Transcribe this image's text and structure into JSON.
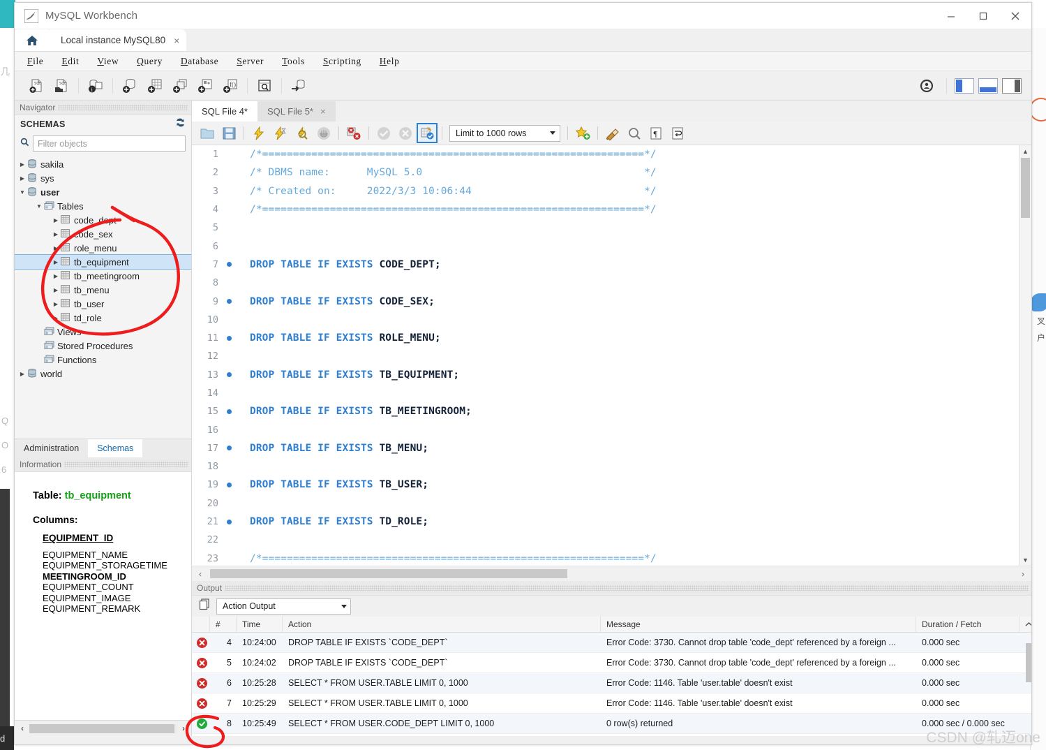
{
  "window": {
    "title": "MySQL Workbench",
    "logo_icon": "mysql-dolphin-icon",
    "minimize_label": "minimize-icon",
    "maximize_label": "maximize-icon",
    "close_label": "close-icon"
  },
  "tabs": {
    "home_icon": "home-icon",
    "connection_tab": "Local instance MySQL80",
    "close_glyph": "×"
  },
  "menubar": {
    "items": [
      {
        "mnemonic": "F",
        "rest": "ile"
      },
      {
        "mnemonic": "E",
        "rest": "dit"
      },
      {
        "mnemonic": "V",
        "rest": "iew"
      },
      {
        "mnemonic": "Q",
        "rest": "uery"
      },
      {
        "mnemonic": "D",
        "rest": "atabase"
      },
      {
        "mnemonic": "S",
        "rest": "erver"
      },
      {
        "mnemonic": "T",
        "rest": "ools"
      },
      {
        "mnemonic": "S",
        "rest": "cripting"
      },
      {
        "mnemonic": "H",
        "rest": "elp"
      }
    ]
  },
  "main_toolbar": {
    "icons": [
      "new-sql-tab-icon",
      "open-sql-script-icon",
      "connection-info-icon",
      "new-schema-icon",
      "new-table-icon",
      "new-view-icon",
      "new-routine-icon",
      "new-function-icon",
      "inspect-schema-icon",
      "reconnect-server-icon"
    ],
    "right_icons": [
      "admin-target-icon",
      "toggle-sidebar-icon",
      "toggle-output-icon",
      "toggle-secondary-sidebar-icon"
    ]
  },
  "navigator": {
    "caption": "Navigator",
    "schemas_label": "SCHEMAS",
    "refresh_icon": "refresh-icon",
    "filter_placeholder": "Filter objects",
    "search_icon": "search-icon",
    "tree": [
      {
        "label": "sakila",
        "level": 1,
        "icon": "schema-icon",
        "expanded": false,
        "bold": false,
        "selected": false
      },
      {
        "label": "sys",
        "level": 1,
        "icon": "schema-icon",
        "expanded": false,
        "bold": false,
        "selected": false
      },
      {
        "label": "user",
        "level": 1,
        "icon": "schema-icon",
        "expanded": true,
        "bold": true,
        "selected": false
      },
      {
        "label": "Tables",
        "level": 2,
        "icon": "folder-tables-icon",
        "expanded": true,
        "bold": false,
        "selected": false
      },
      {
        "label": "code_dept",
        "level": 3,
        "icon": "table-icon",
        "expanded": false,
        "bold": false,
        "selected": false
      },
      {
        "label": "code_sex",
        "level": 3,
        "icon": "table-icon",
        "expanded": false,
        "bold": false,
        "selected": false
      },
      {
        "label": "role_menu",
        "level": 3,
        "icon": "table-icon",
        "expanded": false,
        "bold": false,
        "selected": false
      },
      {
        "label": "tb_equipment",
        "level": 3,
        "icon": "table-icon",
        "expanded": false,
        "bold": false,
        "selected": true
      },
      {
        "label": "tb_meetingroom",
        "level": 3,
        "icon": "table-icon",
        "expanded": false,
        "bold": false,
        "selected": false
      },
      {
        "label": "tb_menu",
        "level": 3,
        "icon": "table-icon",
        "expanded": false,
        "bold": false,
        "selected": false
      },
      {
        "label": "tb_user",
        "level": 3,
        "icon": "table-icon",
        "expanded": false,
        "bold": false,
        "selected": false
      },
      {
        "label": "td_role",
        "level": 3,
        "icon": "table-icon",
        "expanded": false,
        "bold": false,
        "selected": false
      },
      {
        "label": "Views",
        "level": 2,
        "icon": "folder-views-icon",
        "expanded": false,
        "bold": false,
        "selected": false
      },
      {
        "label": "Stored Procedures",
        "level": 2,
        "icon": "folder-procs-icon",
        "expanded": false,
        "bold": false,
        "selected": false
      },
      {
        "label": "Functions",
        "level": 2,
        "icon": "folder-funcs-icon",
        "expanded": false,
        "bold": false,
        "selected": false
      },
      {
        "label": "world",
        "level": 1,
        "icon": "schema-icon",
        "expanded": false,
        "bold": false,
        "selected": false
      }
    ],
    "bottom_tabs": [
      {
        "label": "Administration",
        "active": false
      },
      {
        "label": "Schemas",
        "active": true
      }
    ]
  },
  "information": {
    "caption": "Information",
    "table_prefix": "Table:",
    "table_name": "tb_equipment",
    "columns_label": "Columns:",
    "columns": [
      {
        "name": "EQUIPMENT_ID",
        "key": "pk"
      },
      {
        "name": "EQUIPMENT_NAME",
        "key": ""
      },
      {
        "name": "EQUIPMENT_STORAGETIME",
        "key": ""
      },
      {
        "name": "MEETINGROOM_ID",
        "key": "fk"
      },
      {
        "name": "EQUIPMENT_COUNT",
        "key": ""
      },
      {
        "name": "EQUIPMENT_IMAGE",
        "key": ""
      },
      {
        "name": "EQUIPMENT_REMARK",
        "key": ""
      }
    ]
  },
  "editor": {
    "tabs": [
      {
        "label": "SQL File 4*",
        "active": true,
        "closable": false
      },
      {
        "label": "SQL File 5*",
        "active": false,
        "closable": true
      }
    ],
    "toolbar": {
      "icons": [
        "open-file-icon",
        "save-file-icon",
        "execute-icon",
        "execute-current-icon",
        "explain-icon",
        "stop-icon",
        "toggle-stop-on-error-icon",
        "commit-icon",
        "rollback-icon",
        "autocommit-icon"
      ],
      "limit_label": "Limit to 1000 rows",
      "right_icons": [
        "toggle-snippets-icon",
        "beautify-sql-icon",
        "find-icon",
        "toggle-invisible-chars-icon",
        "wrap-lines-icon"
      ]
    },
    "lines": [
      {
        "n": 1,
        "bp": false,
        "segments": [
          {
            "t": "/*==============================================================*/",
            "c": "cmt"
          }
        ]
      },
      {
        "n": 2,
        "bp": false,
        "segments": [
          {
            "t": "/* DBMS name:      MySQL 5.0                                    */",
            "c": "cmt"
          }
        ]
      },
      {
        "n": 3,
        "bp": false,
        "segments": [
          {
            "t": "/* Created on:     2022/3/3 10:06:44                            */",
            "c": "cmt"
          }
        ]
      },
      {
        "n": 4,
        "bp": false,
        "segments": [
          {
            "t": "/*==============================================================*/",
            "c": "cmt"
          }
        ]
      },
      {
        "n": 5,
        "bp": false,
        "segments": []
      },
      {
        "n": 6,
        "bp": false,
        "segments": []
      },
      {
        "n": 7,
        "bp": true,
        "segments": [
          {
            "t": "DROP TABLE IF EXISTS ",
            "c": "kw"
          },
          {
            "t": "CODE_DEPT;",
            "c": "idn"
          }
        ]
      },
      {
        "n": 8,
        "bp": false,
        "segments": []
      },
      {
        "n": 9,
        "bp": true,
        "segments": [
          {
            "t": "DROP TABLE IF EXISTS ",
            "c": "kw"
          },
          {
            "t": "CODE_SEX;",
            "c": "idn"
          }
        ]
      },
      {
        "n": 10,
        "bp": false,
        "segments": []
      },
      {
        "n": 11,
        "bp": true,
        "segments": [
          {
            "t": "DROP TABLE IF EXISTS ",
            "c": "kw"
          },
          {
            "t": "ROLE_MENU;",
            "c": "idn"
          }
        ]
      },
      {
        "n": 12,
        "bp": false,
        "segments": []
      },
      {
        "n": 13,
        "bp": true,
        "segments": [
          {
            "t": "DROP TABLE IF EXISTS ",
            "c": "kw"
          },
          {
            "t": "TB_EQUIPMENT;",
            "c": "idn"
          }
        ]
      },
      {
        "n": 14,
        "bp": false,
        "segments": []
      },
      {
        "n": 15,
        "bp": true,
        "segments": [
          {
            "t": "DROP TABLE IF EXISTS ",
            "c": "kw"
          },
          {
            "t": "TB_MEETINGROOM;",
            "c": "idn"
          }
        ]
      },
      {
        "n": 16,
        "bp": false,
        "segments": []
      },
      {
        "n": 17,
        "bp": true,
        "segments": [
          {
            "t": "DROP TABLE IF EXISTS ",
            "c": "kw"
          },
          {
            "t": "TB_MENU;",
            "c": "idn"
          }
        ]
      },
      {
        "n": 18,
        "bp": false,
        "segments": []
      },
      {
        "n": 19,
        "bp": true,
        "segments": [
          {
            "t": "DROP TABLE IF EXISTS ",
            "c": "kw"
          },
          {
            "t": "TB_USER;",
            "c": "idn"
          }
        ]
      },
      {
        "n": 20,
        "bp": false,
        "segments": []
      },
      {
        "n": 21,
        "bp": true,
        "segments": [
          {
            "t": "DROP TABLE IF EXISTS ",
            "c": "kw"
          },
          {
            "t": "TD_ROLE;",
            "c": "idn"
          }
        ]
      },
      {
        "n": 22,
        "bp": false,
        "segments": []
      },
      {
        "n": 23,
        "bp": false,
        "segments": [
          {
            "t": "/*==============================================================*/",
            "c": "cmt"
          }
        ]
      }
    ]
  },
  "output": {
    "caption": "Output",
    "mode_icon": "output-mode-icon",
    "mode_label": "Action Output",
    "headers": [
      "",
      "#",
      "Time",
      "Action",
      "Message",
      "Duration / Fetch"
    ],
    "rows": [
      {
        "status": "error",
        "num": "4",
        "time": "10:24:00",
        "action": "DROP TABLE IF EXISTS `CODE_DEPT`",
        "message": "Error Code: 3730. Cannot drop table 'code_dept' referenced by a foreign ...",
        "duration": "0.000 sec"
      },
      {
        "status": "error",
        "num": "5",
        "time": "10:24:02",
        "action": "DROP TABLE IF EXISTS `CODE_DEPT`",
        "message": "Error Code: 3730. Cannot drop table 'code_dept' referenced by a foreign ...",
        "duration": "0.000 sec"
      },
      {
        "status": "error",
        "num": "6",
        "time": "10:25:28",
        "action": "SELECT * FROM USER.TABLE LIMIT 0, 1000",
        "message": "Error Code: 1146. Table 'user.table' doesn't exist",
        "duration": "0.000 sec"
      },
      {
        "status": "error",
        "num": "7",
        "time": "10:25:29",
        "action": "SELECT * FROM USER.TABLE LIMIT 0, 1000",
        "message": "Error Code: 1146. Table 'user.table' doesn't exist",
        "duration": "0.000 sec"
      },
      {
        "status": "ok",
        "num": "8",
        "time": "10:25:49",
        "action": "SELECT * FROM USER.CODE_DEPT LIMIT 0, 1000",
        "message": "0 row(s) returned",
        "duration": "0.000 sec / 0.000 sec"
      }
    ]
  },
  "annotations": {
    "color": "#ee1c1c",
    "tables_circle": "hand-drawn-circle-around-table-list",
    "status_circle": "hand-drawn-circle-around-success-icon"
  },
  "watermark": {
    "text": "CSDN @轧迈one"
  }
}
